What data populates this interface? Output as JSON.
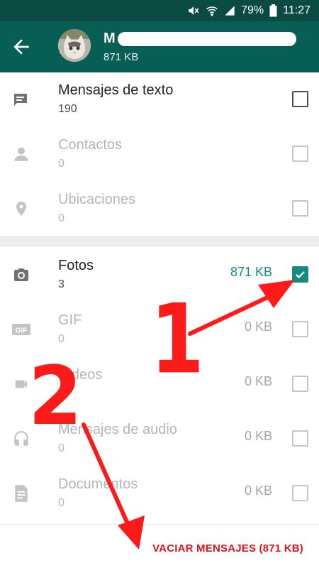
{
  "status_bar": {
    "battery": "79%",
    "time": "11:27"
  },
  "header": {
    "title": "M",
    "subtitle": "871 KB"
  },
  "items": [
    {
      "label": "Mensajes de texto",
      "count": "190",
      "size": "",
      "icon": "message-icon",
      "checked": false
    },
    {
      "label": "Contactos",
      "count": "0",
      "size": "",
      "icon": "person-icon",
      "checked": false
    },
    {
      "label": "Ubicaciones",
      "count": "0",
      "size": "",
      "icon": "location-pin-icon",
      "checked": false
    },
    {
      "label": "Fotos",
      "count": "3",
      "size": "871 KB",
      "icon": "camera-icon",
      "checked": true
    },
    {
      "label": "GIF",
      "count": "0",
      "size": "0 KB",
      "icon": "gif-icon",
      "checked": false
    },
    {
      "label": "Vídeos",
      "count": "0",
      "size": "0 KB",
      "icon": "video-camera-icon",
      "checked": false
    },
    {
      "label": "Mensajes de audio",
      "count": "0",
      "size": "0 KB",
      "icon": "headphones-icon",
      "checked": false
    },
    {
      "label": "Documentos",
      "count": "0",
      "size": "0 KB",
      "icon": "document-icon",
      "checked": false
    }
  ],
  "clear_button": {
    "label": "VACIAR MENSAJES (871 KB)"
  },
  "annotations": {
    "step_1": "1",
    "step_2": "2"
  },
  "colors": {
    "toolbar": "#075e54",
    "status_bar": "#0b4a43",
    "accent": "#128c7e",
    "clear_button": "#e2131b",
    "annotation": "#ff1a1a"
  }
}
